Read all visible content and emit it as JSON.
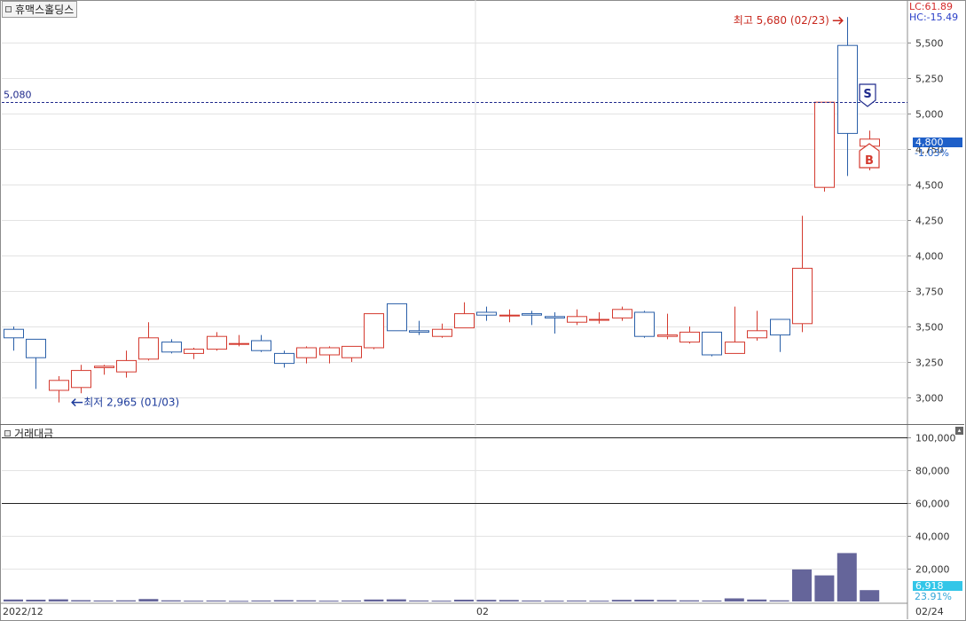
{
  "stock_name": "휴맥스홀딩스",
  "subpanel_title": "거래대금",
  "icons": {
    "panel_menu": "square-menu-icon",
    "subpanel_menu": "square-menu-icon",
    "collapse": "collapse-icon"
  },
  "indicators": {
    "lc": "LC:61.89",
    "hc": "HC:-15.49"
  },
  "current_price": {
    "value": "4,800",
    "change": "-1.03%"
  },
  "current_volume": {
    "value": "6,918",
    "ratio": "23.91%"
  },
  "reference_line_label": "5,080",
  "annotations": {
    "high": "최고 5,680 (02/23)",
    "low": "최저 2,965 (01/03)",
    "sell_marker": "S",
    "buy_marker": "B"
  },
  "x_labels": {
    "start": "2022/12",
    "mid": "02",
    "end": "02/24"
  },
  "colors": {
    "up": "#d43a2f",
    "down": "#2a5fa8",
    "ref_line": "#1f2a8c",
    "volume_bar": "#65659a",
    "price_tag": "#1e5fc8",
    "volume_tag": "#33c6e8",
    "high_label": "#c8281e",
    "low_label": "#1e3c9c"
  },
  "chart_data": {
    "type": "candlestick",
    "price_axis": {
      "min": 2900,
      "max": 5700,
      "ticks": [
        "5,500",
        "5,250",
        "5,000",
        "4,750",
        "4,500",
        "4,250",
        "4,000",
        "3,750",
        "3,500",
        "3,250",
        "3,000"
      ]
    },
    "volume_axis": {
      "min": 0,
      "max": 100000,
      "ticks": [
        "100,000",
        "80,000",
        "60,000",
        "40,000",
        "20,000"
      ]
    },
    "reference_line": 5080,
    "candles": [
      {
        "o": 3480,
        "h": 3500,
        "l": 3330,
        "c": 3420
      },
      {
        "o": 3410,
        "h": 3380,
        "l": 3060,
        "c": 3280
      },
      {
        "o": 3050,
        "h": 3150,
        "l": 2965,
        "c": 3120
      },
      {
        "o": 3070,
        "h": 3230,
        "l": 3030,
        "c": 3190
      },
      {
        "o": 3210,
        "h": 3230,
        "l": 3160,
        "c": 3220
      },
      {
        "o": 3180,
        "h": 3330,
        "l": 3140,
        "c": 3260
      },
      {
        "o": 3270,
        "h": 3530,
        "l": 3260,
        "c": 3420
      },
      {
        "o": 3390,
        "h": 3410,
        "l": 3310,
        "c": 3320
      },
      {
        "o": 3310,
        "h": 3350,
        "l": 3270,
        "c": 3340
      },
      {
        "o": 3340,
        "h": 3460,
        "l": 3330,
        "c": 3430
      },
      {
        "o": 3380,
        "h": 3440,
        "l": 3360,
        "c": 3380
      },
      {
        "o": 3400,
        "h": 3440,
        "l": 3320,
        "c": 3330
      },
      {
        "o": 3310,
        "h": 3330,
        "l": 3210,
        "c": 3240
      },
      {
        "o": 3280,
        "h": 3360,
        "l": 3240,
        "c": 3350
      },
      {
        "o": 3300,
        "h": 3360,
        "l": 3240,
        "c": 3350
      },
      {
        "o": 3280,
        "h": 3360,
        "l": 3250,
        "c": 3360
      },
      {
        "o": 3350,
        "h": 3590,
        "l": 3340,
        "c": 3590
      },
      {
        "o": 3660,
        "h": 3660,
        "l": 3470,
        "c": 3470
      },
      {
        "o": 3470,
        "h": 3540,
        "l": 3440,
        "c": 3460
      },
      {
        "o": 3430,
        "h": 3520,
        "l": 3420,
        "c": 3480
      },
      {
        "o": 3490,
        "h": 3670,
        "l": 3490,
        "c": 3590
      },
      {
        "o": 3600,
        "h": 3640,
        "l": 3540,
        "c": 3580
      },
      {
        "o": 3580,
        "h": 3620,
        "l": 3530,
        "c": 3580
      },
      {
        "o": 3590,
        "h": 3610,
        "l": 3510,
        "c": 3580
      },
      {
        "o": 3570,
        "h": 3600,
        "l": 3450,
        "c": 3560
      },
      {
        "o": 3530,
        "h": 3620,
        "l": 3510,
        "c": 3570
      },
      {
        "o": 3550,
        "h": 3600,
        "l": 3520,
        "c": 3550
      },
      {
        "o": 3560,
        "h": 3640,
        "l": 3540,
        "c": 3620
      },
      {
        "o": 3600,
        "h": 3610,
        "l": 3420,
        "c": 3430
      },
      {
        "o": 3430,
        "h": 3590,
        "l": 3410,
        "c": 3440
      },
      {
        "o": 3390,
        "h": 3500,
        "l": 3380,
        "c": 3460
      },
      {
        "o": 3460,
        "h": 3460,
        "l": 3290,
        "c": 3300
      },
      {
        "o": 3310,
        "h": 3640,
        "l": 3310,
        "c": 3390
      },
      {
        "o": 3420,
        "h": 3610,
        "l": 3400,
        "c": 3470
      },
      {
        "o": 3550,
        "h": 3550,
        "l": 3320,
        "c": 3440
      },
      {
        "o": 3520,
        "h": 4280,
        "l": 3460,
        "c": 3910
      },
      {
        "o": 4480,
        "h": 5080,
        "l": 4450,
        "c": 5080
      },
      {
        "o": 5480,
        "h": 5680,
        "l": 4560,
        "c": 4860
      },
      {
        "o": 4770,
        "h": 4880,
        "l": 4600,
        "c": 4820
      }
    ],
    "volume": [
      1200,
      1100,
      1300,
      800,
      600,
      700,
      1500,
      700,
      500,
      600,
      400,
      600,
      800,
      700,
      500,
      600,
      1200,
      1300,
      600,
      500,
      1100,
      1000,
      900,
      600,
      500,
      600,
      500,
      1000,
      1100,
      900,
      700,
      600,
      1900,
      1200,
      700,
      19500,
      15900,
      29500,
      6918
    ]
  }
}
